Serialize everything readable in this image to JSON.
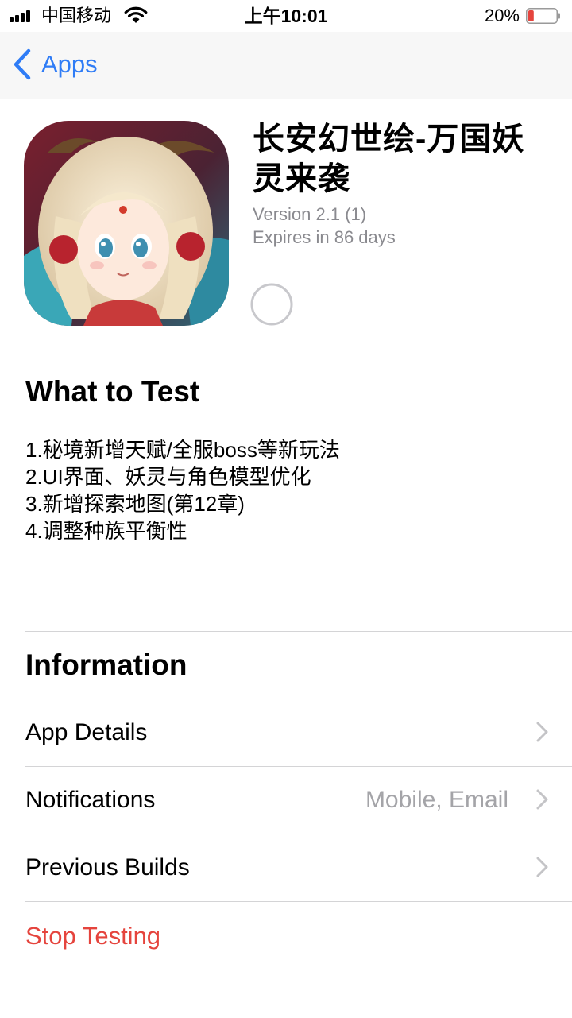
{
  "status_bar": {
    "carrier": "中国移动",
    "time": "上午10:01",
    "battery_percent": "20%",
    "battery_level": 0.2,
    "battery_color": "#e5443d"
  },
  "nav": {
    "back_label": "Apps",
    "accent_color": "#2f7cf6"
  },
  "app": {
    "title": "长安幻世绘-万国妖灵来袭",
    "version": "Version 2.1 (1)",
    "expiry": "Expires in 86 days",
    "icon": "app-icon-anime-girl"
  },
  "what_to_test": {
    "heading": "What to Test",
    "notes": [
      "1.秘境新增天赋/全服boss等新玩法",
      "2.UI界面、妖灵与角色模型优化",
      "3.新增探索地图(第12章)",
      "4.调整种族平衡性"
    ]
  },
  "information": {
    "heading": "Information",
    "rows": [
      {
        "label": "App Details",
        "value": ""
      },
      {
        "label": "Notifications",
        "value": "Mobile, Email"
      },
      {
        "label": "Previous Builds",
        "value": ""
      }
    ],
    "stop_label": "Stop Testing",
    "stop_color": "#e5443d"
  }
}
